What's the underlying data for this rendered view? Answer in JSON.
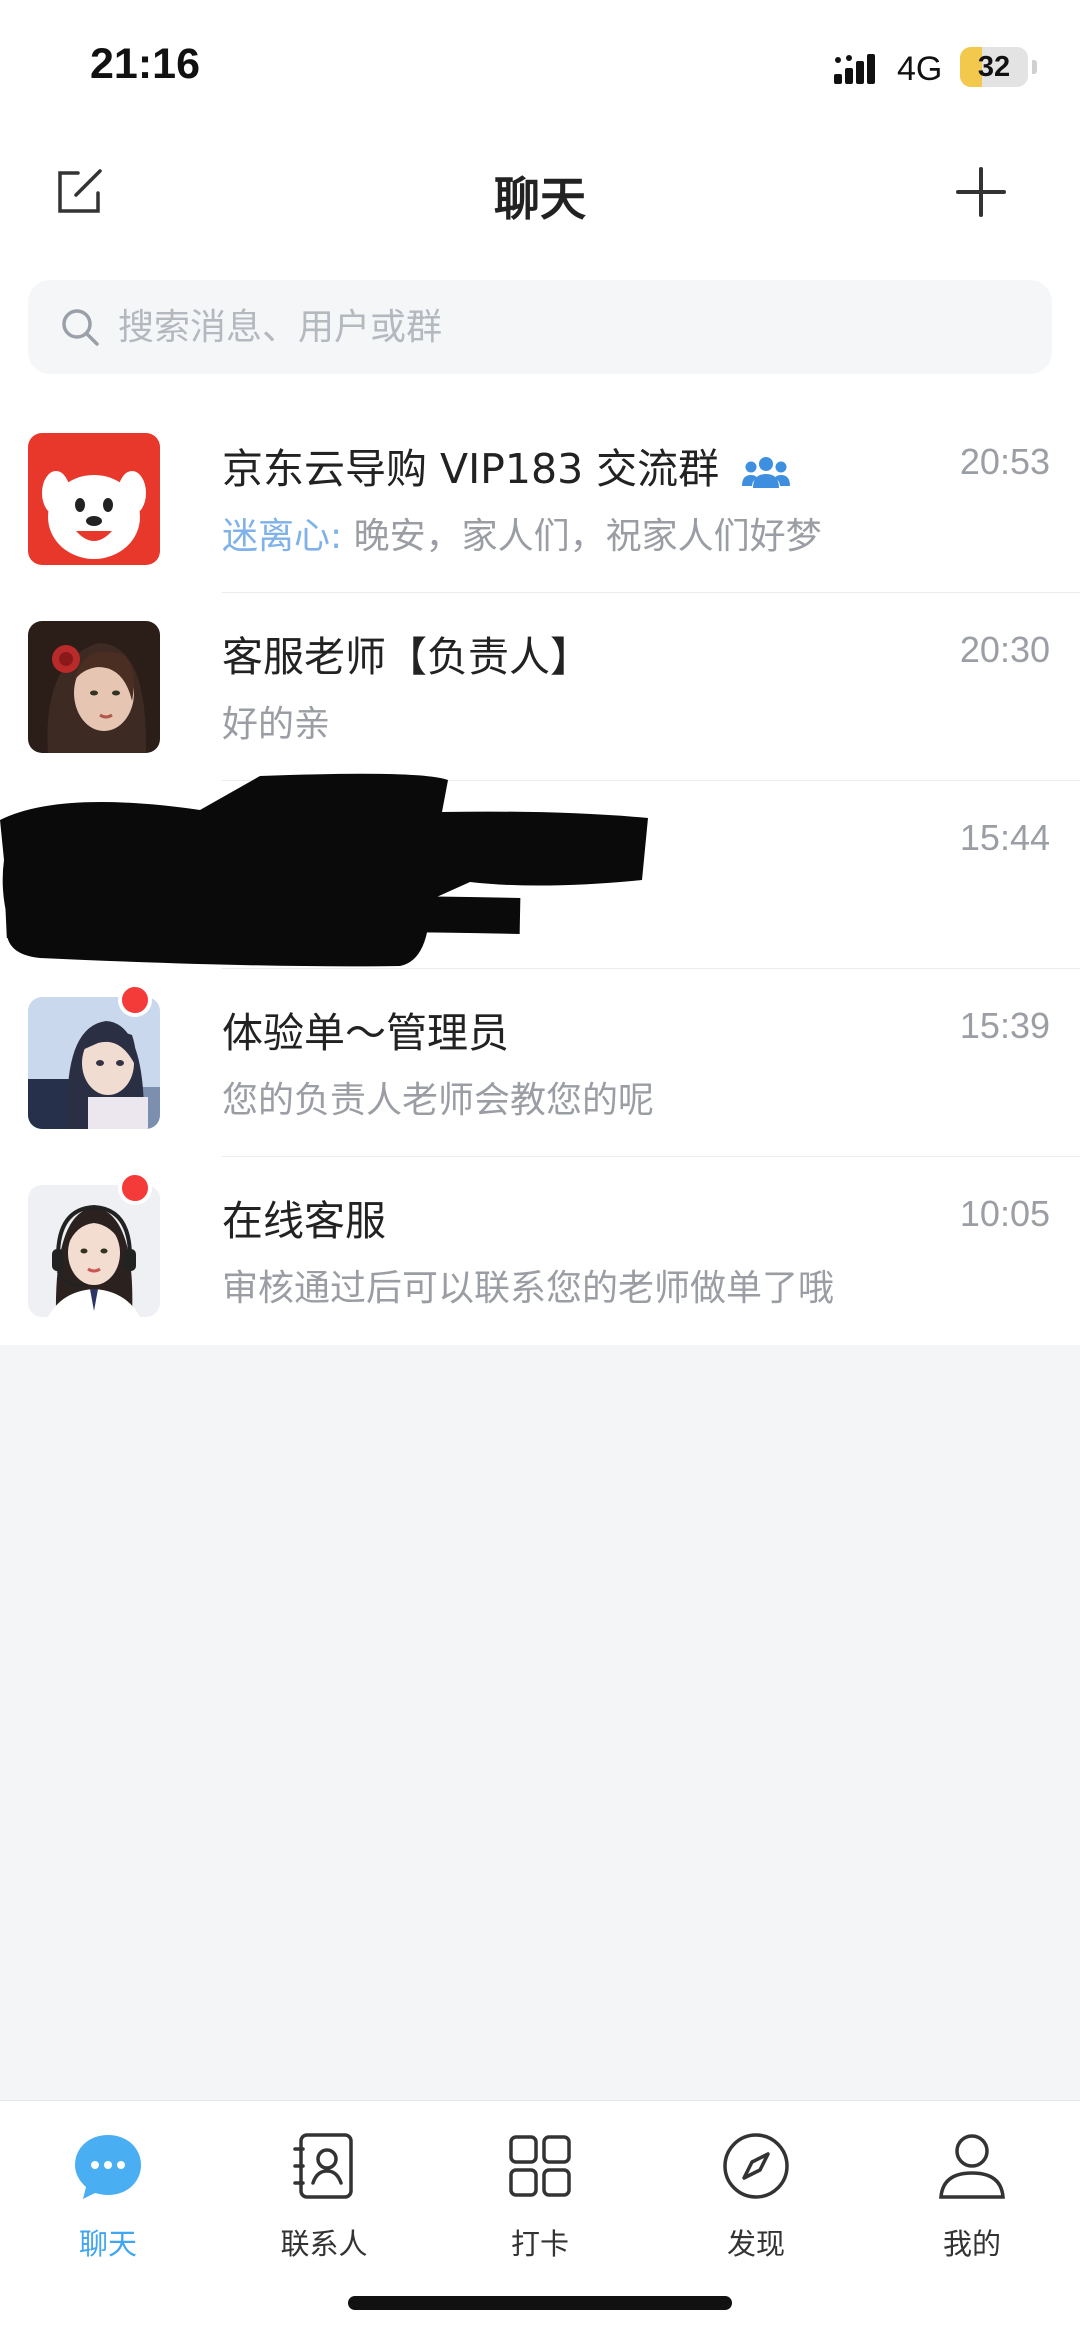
{
  "status_bar": {
    "time": "21:16",
    "network": "4G",
    "battery": "32",
    "battery_level": 0.32
  },
  "header": {
    "title": "聊天",
    "compose_icon": "compose-icon",
    "add_icon": "plus-icon"
  },
  "search": {
    "placeholder": "搜索消息、用户或群",
    "icon": "search-icon"
  },
  "chats": [
    {
      "name": "京东云导购 VIP183 交流群",
      "is_group": true,
      "time": "20:53",
      "sender": "迷离心:",
      "preview": "晚安，家人们，祝家人们好梦",
      "unread": false
    },
    {
      "name": "客服老师【负责人】",
      "time": "20:30",
      "preview": "好的亲",
      "unread": false
    },
    {
      "name": "",
      "time": "15:44",
      "preview": "",
      "unread": false,
      "redacted": true
    },
    {
      "name": "体验单～管理员",
      "time": "15:39",
      "preview": "您的负责人老师会教您的呢",
      "unread": true
    },
    {
      "name": "在线客服",
      "time": "10:05",
      "preview": "审核通过后可以联系您的老师做单了哦",
      "unread": true
    }
  ],
  "tabs": [
    {
      "label": "聊天",
      "icon": "chat-bubble-icon",
      "active": true
    },
    {
      "label": "联系人",
      "icon": "contacts-icon",
      "active": false
    },
    {
      "label": "打卡",
      "icon": "grid-icon",
      "active": false
    },
    {
      "label": "发现",
      "icon": "compass-icon",
      "active": false
    },
    {
      "label": "我的",
      "icon": "person-icon",
      "active": false
    }
  ],
  "colors": {
    "accent": "#3fa6ef",
    "unread_dot": "#f53a3a",
    "sender_name": "#7fb2e8",
    "battery_fill": "#f2c94c"
  }
}
